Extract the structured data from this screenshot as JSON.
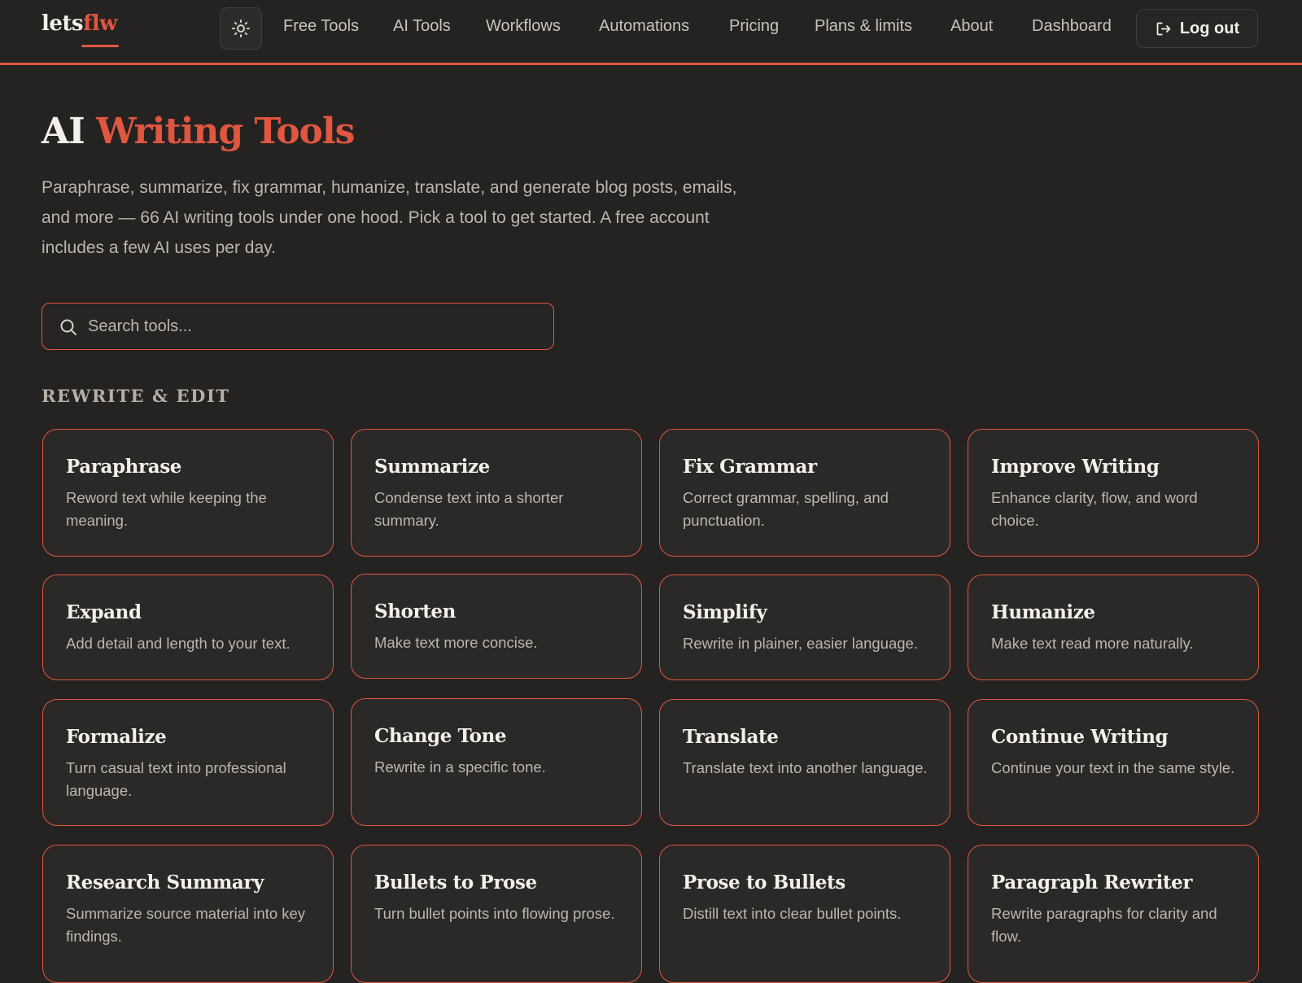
{
  "header": {
    "logo_main": "lets",
    "logo_accent": "flw",
    "nav": [
      "Free Tools",
      "AI Tools",
      "Workflows",
      "Automations",
      "Pricing",
      "Plans & limits",
      "About",
      "Dashboard"
    ],
    "logout_label": "Log out",
    "theme_icon": "sun-icon",
    "logout_icon": "log-out-icon"
  },
  "hero": {
    "title_plain": "AI",
    "title_accent": "Writing Tools",
    "intro": "Paraphrase, summarize, fix grammar, humanize, translate, and generate blog posts, emails, and more — 66 AI writing tools under one hood. Pick a tool to get started. A free account includes a few AI uses per day."
  },
  "search": {
    "placeholder": "Search tools...",
    "value": "",
    "icon": "search-icon"
  },
  "section": {
    "title": "REWRITE & EDIT"
  },
  "tools": [
    {
      "title": "Paraphrase",
      "desc": "Reword text while keeping the meaning."
    },
    {
      "title": "Summarize",
      "desc": "Condense text into a shorter summary."
    },
    {
      "title": "Fix Grammar",
      "desc": "Correct grammar, spelling, and punctuation."
    },
    {
      "title": "Improve Writing",
      "desc": "Enhance clarity, flow, and word choice."
    },
    {
      "title": "Expand",
      "desc": "Add detail and length to your text."
    },
    {
      "title": "Shorten",
      "desc": "Make text more concise."
    },
    {
      "title": "Simplify",
      "desc": "Rewrite in plainer, easier language."
    },
    {
      "title": "Humanize",
      "desc": "Make text read more naturally."
    },
    {
      "title": "Formalize",
      "desc": "Turn casual text into professional language."
    },
    {
      "title": "Change Tone",
      "desc": "Rewrite in a specific tone."
    },
    {
      "title": "Translate",
      "desc": "Translate text into another language."
    },
    {
      "title": "Continue Writing",
      "desc": "Continue your text in the same style."
    },
    {
      "title": "Research Summary",
      "desc": "Summarize source material into key findings."
    },
    {
      "title": "Bullets to Prose",
      "desc": "Turn bullet points into flowing prose."
    },
    {
      "title": "Prose to Bullets",
      "desc": "Distill text into clear bullet points."
    },
    {
      "title": "Paragraph Rewriter",
      "desc": "Rewrite paragraphs for clarity and flow."
    }
  ],
  "colors": {
    "accent": "#e0563f",
    "background": "#242322",
    "card_background": "#2a2928"
  }
}
